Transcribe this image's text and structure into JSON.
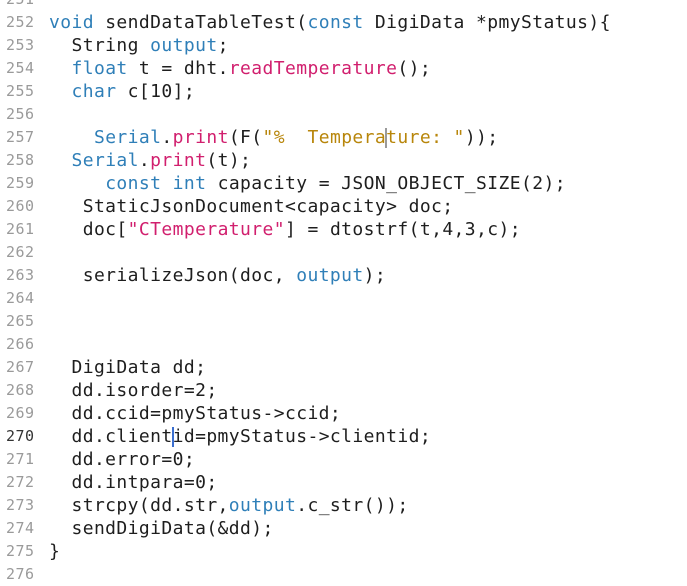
{
  "editor": {
    "first_line_partial": "251",
    "lines": [
      {
        "num": "252",
        "tokens": [
          [
            "kw",
            "void"
          ],
          [
            "plain",
            " sendDataTableTest("
          ],
          [
            "kw",
            "const"
          ],
          [
            "plain",
            " DigiData *pmyStatus){"
          ]
        ]
      },
      {
        "num": "253",
        "tokens": [
          [
            "plain",
            "  String "
          ],
          [
            "kw",
            "output"
          ],
          [
            "plain",
            ";"
          ]
        ]
      },
      {
        "num": "254",
        "tokens": [
          [
            "plain",
            "  "
          ],
          [
            "kw",
            "float"
          ],
          [
            "plain",
            " t = dht."
          ],
          [
            "fn",
            "readTemperature"
          ],
          [
            "plain",
            "();"
          ]
        ]
      },
      {
        "num": "255",
        "tokens": [
          [
            "plain",
            "  "
          ],
          [
            "kw",
            "char"
          ],
          [
            "plain",
            " c[10];"
          ]
        ]
      },
      {
        "num": "256",
        "tokens": []
      },
      {
        "num": "257",
        "tokens": [
          [
            "plain",
            "    "
          ],
          [
            "kw",
            "Serial"
          ],
          [
            "plain",
            "."
          ],
          [
            "fn",
            "print"
          ],
          [
            "plain",
            "(F("
          ],
          [
            "str",
            "\"%  Tempera"
          ],
          [
            "caret",
            "ghost"
          ],
          [
            "str",
            "ture: \""
          ],
          [
            "plain",
            "));"
          ]
        ]
      },
      {
        "num": "258",
        "tokens": [
          [
            "plain",
            "  "
          ],
          [
            "kw",
            "Serial"
          ],
          [
            "plain",
            "."
          ],
          [
            "fn",
            "print"
          ],
          [
            "plain",
            "(t);"
          ]
        ]
      },
      {
        "num": "259",
        "tokens": [
          [
            "plain",
            "     "
          ],
          [
            "kw",
            "const"
          ],
          [
            "plain",
            " "
          ],
          [
            "kw",
            "int"
          ],
          [
            "plain",
            " capacity = JSON_OBJECT_SIZE(2);"
          ]
        ]
      },
      {
        "num": "260",
        "tokens": [
          [
            "plain",
            "   StaticJsonDocument<capacity> doc;"
          ]
        ]
      },
      {
        "num": "261",
        "tokens": [
          [
            "plain",
            "   doc["
          ],
          [
            "fn",
            "\"CTemperature\""
          ],
          [
            "plain",
            "] = dtostrf(t,4,3,c);"
          ]
        ]
      },
      {
        "num": "262",
        "tokens": []
      },
      {
        "num": "263",
        "tokens": [
          [
            "plain",
            "   serializeJson(doc, "
          ],
          [
            "kw",
            "output"
          ],
          [
            "plain",
            ");"
          ]
        ]
      },
      {
        "num": "264",
        "tokens": []
      },
      {
        "num": "265",
        "tokens": []
      },
      {
        "num": "266",
        "tokens": []
      },
      {
        "num": "267",
        "tokens": [
          [
            "plain",
            "  DigiData dd;"
          ]
        ]
      },
      {
        "num": "268",
        "tokens": [
          [
            "plain",
            "  dd.isorder=2;"
          ]
        ]
      },
      {
        "num": "269",
        "tokens": [
          [
            "plain",
            "  dd.ccid=pmyStatus->ccid;"
          ]
        ]
      },
      {
        "num": "270",
        "current": true,
        "tokens": [
          [
            "plain",
            "  dd.client"
          ],
          [
            "caret",
            "active"
          ],
          [
            "plain",
            "id=pmyStatus->clientid;"
          ]
        ]
      },
      {
        "num": "271",
        "tokens": [
          [
            "plain",
            "  dd.error=0;"
          ]
        ]
      },
      {
        "num": "272",
        "tokens": [
          [
            "plain",
            "  dd.intpara=0;"
          ]
        ]
      },
      {
        "num": "273",
        "tokens": [
          [
            "plain",
            "  strcpy(dd.str,"
          ],
          [
            "kw",
            "output"
          ],
          [
            "plain",
            ".c_str());"
          ]
        ]
      },
      {
        "num": "274",
        "tokens": [
          [
            "plain",
            "  sendDigiData(&dd);"
          ]
        ]
      },
      {
        "num": "275",
        "tokens": [
          [
            "plain",
            "}"
          ]
        ]
      },
      {
        "num": "276",
        "tokens": []
      }
    ]
  },
  "colors": {
    "keyword": "#2f7fb8",
    "function": "#d11f6e",
    "string": "#b8860b",
    "text": "#1e1e1e",
    "line_number": "#9a9a9a",
    "caret": "#3b6fd0"
  }
}
